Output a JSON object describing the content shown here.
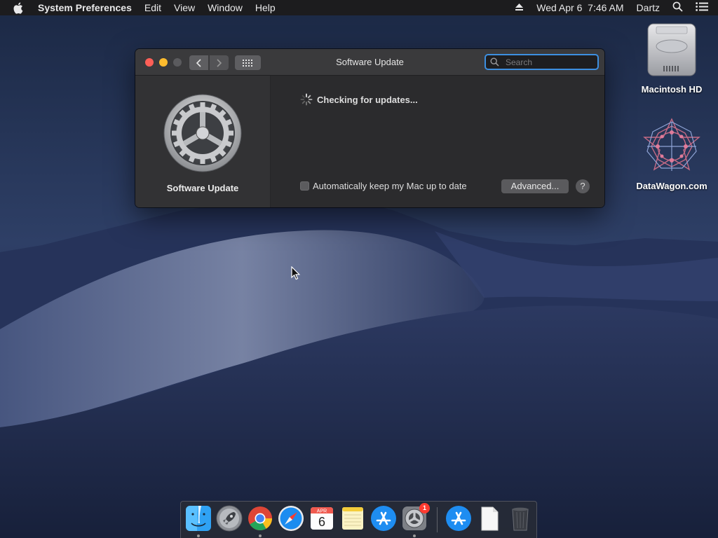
{
  "menubar": {
    "app_name": "System Preferences",
    "items": [
      "Edit",
      "View",
      "Window",
      "Help"
    ],
    "datetime": "Wed Apr 6  7:46 AM",
    "user": "Dartz"
  },
  "desktop": {
    "icons": [
      {
        "label": "Macintosh HD"
      },
      {
        "label": "DataWagon.com"
      }
    ]
  },
  "window": {
    "title": "Software Update",
    "search_placeholder": "Search",
    "pane_label": "Software Update",
    "status_text": "Checking for updates...",
    "auto_update_label": "Automatically keep my Mac up to date",
    "auto_update_checked": false,
    "advanced_label": "Advanced...",
    "help_label": "?"
  },
  "dock": {
    "calendar_month": "APR",
    "calendar_day": "6",
    "sysprefs_badge": "1"
  },
  "colors": {
    "accent": "#3d8fe0",
    "close": "#fe5f57",
    "minimize": "#febc2e",
    "badge": "#ff3b30"
  }
}
